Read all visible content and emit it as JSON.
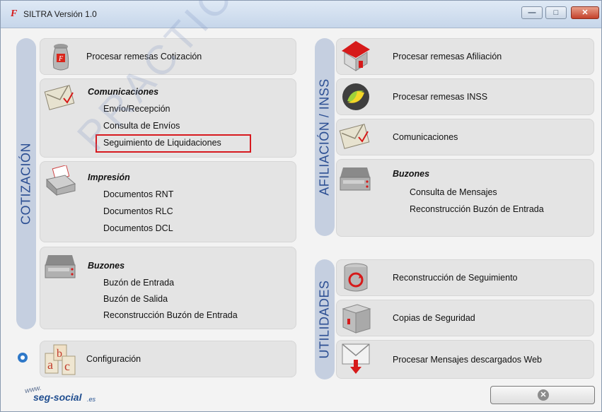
{
  "window": {
    "app_icon": "siltra-icon",
    "title": "SILTRA Versión 1.0",
    "controls": {
      "minimize": "—",
      "maximize": "□",
      "close": "✕"
    }
  },
  "watermark": "PRACTICAS",
  "sections": {
    "cotizacion": "COTIZACIÓN",
    "afiliacion": "AFILIACIÓN / INSS",
    "utilidades": "UTILIDADES"
  },
  "cotizacion": {
    "remesas": "Procesar remesas Cotización",
    "comunicaciones": {
      "title": "Comunicaciones",
      "items": [
        "Envío/Recepción",
        "Consulta de Envíos",
        "Seguimiento de Liquidaciones"
      ]
    },
    "impresion": {
      "title": "Impresión",
      "items": [
        "Documentos RNT",
        "Documentos RLC",
        "Documentos DCL"
      ]
    },
    "buzones": {
      "title": "Buzones",
      "items": [
        "Buzón de Entrada",
        "Buzón de Salida",
        "Reconstrucción Buzón de Entrada"
      ]
    },
    "configuracion": "Configuración"
  },
  "afiliacion": {
    "remesas_afiliacion": "Procesar remesas Afiliación",
    "remesas_inss": "Procesar remesas INSS",
    "comunicaciones": "Comunicaciones",
    "buzones": {
      "title": "Buzones",
      "items": [
        "Consulta de Mensajes",
        "Reconstrucción Buzón de Entrada"
      ]
    }
  },
  "utilidades": {
    "reconstruccion": "Reconstrucción de Seguimiento",
    "copias": "Copias de Seguridad",
    "mensajes_web": "Procesar Mensajes descargados Web"
  },
  "footer": {
    "logo_www": "www.",
    "logo_seg": "seg-social",
    "logo_es": ".es",
    "close_glyph": "✕"
  },
  "colors": {
    "section_text": "#2c4f93",
    "section_bar": "#c5cfe0",
    "highlight": "#d7191f"
  }
}
